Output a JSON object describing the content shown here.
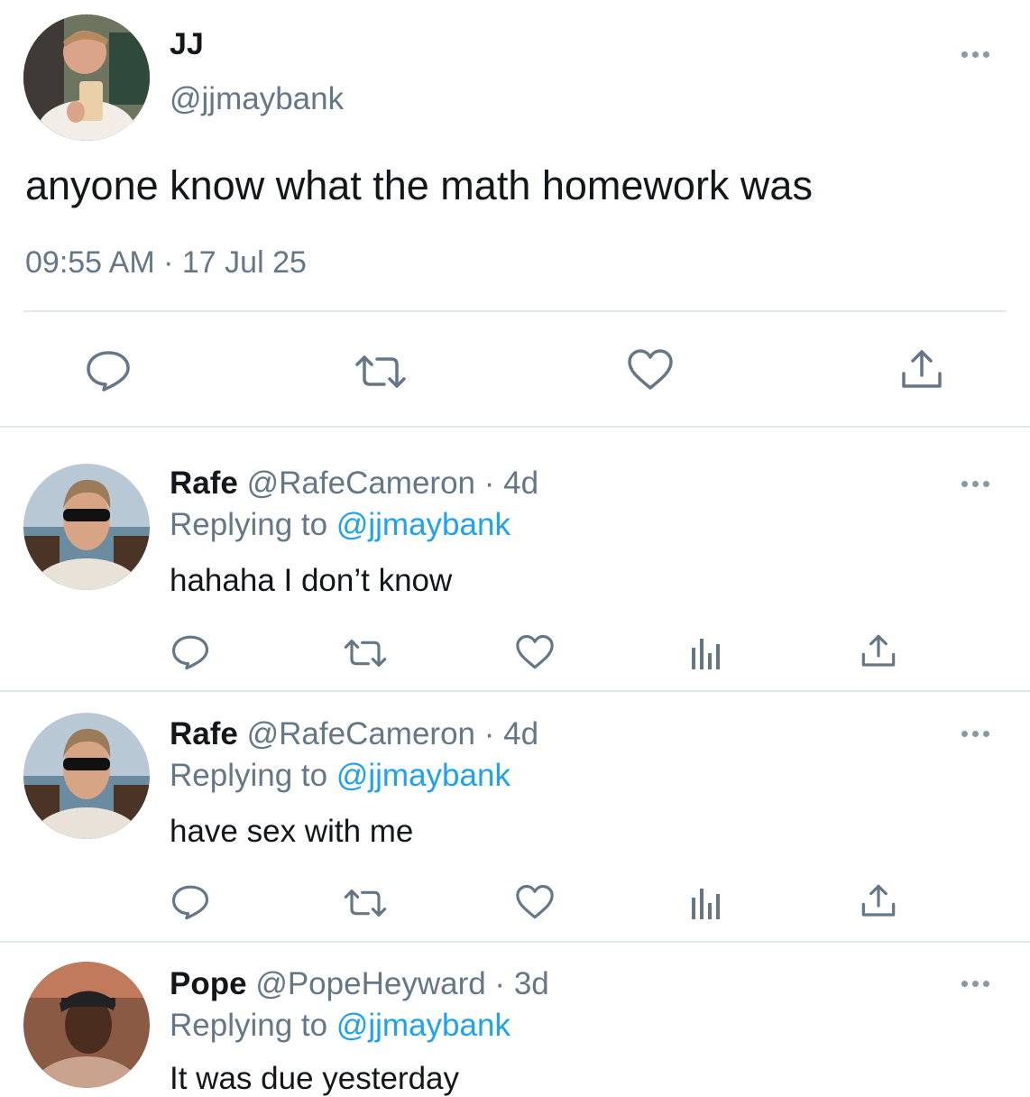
{
  "main_tweet": {
    "name": "JJ",
    "handle": "@jjmaybank",
    "text": "anyone know what the math homework was",
    "time": "09:55 AM",
    "separator": "·",
    "date": "17 Jul 25"
  },
  "replies": [
    {
      "name": "Rafe",
      "handle": "@RafeCameron",
      "dot": "·",
      "age": "4d",
      "replying_prefix": "Replying to",
      "replying_to": "@jjmaybank",
      "text": "hahaha I don’t know"
    },
    {
      "name": "Rafe",
      "handle": "@RafeCameron",
      "dot": "·",
      "age": "4d",
      "replying_prefix": "Replying to",
      "replying_to": "@jjmaybank",
      "text": "have sex with me"
    },
    {
      "name": "Pope",
      "handle": "@PopeHeyward",
      "dot": "·",
      "age": "3d",
      "replying_prefix": "Replying to",
      "replying_to": "@jjmaybank",
      "text": "It was due yesterday"
    }
  ],
  "icons": {
    "reply": "comment-icon",
    "retweet": "retweet-icon",
    "like": "heart-icon",
    "analytics": "analytics-icon",
    "share": "share-icon",
    "more": "more-icon"
  },
  "colors": {
    "link": "#1da1f2",
    "secondary_text": "#657786",
    "icon": "#657786",
    "divider": "#e1e8ed"
  }
}
